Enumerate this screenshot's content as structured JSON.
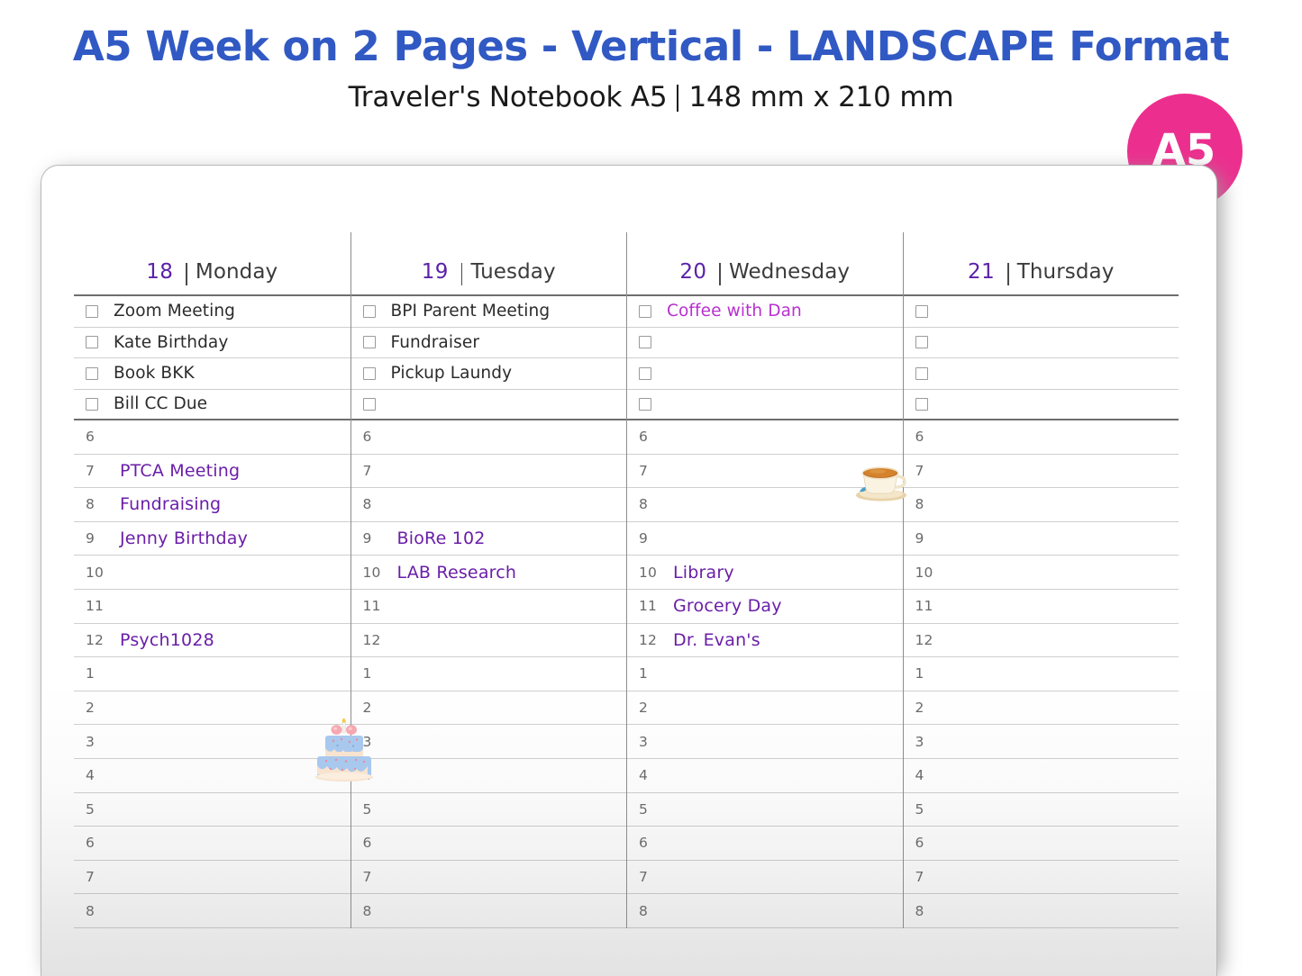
{
  "header": {
    "title": "A5 Week on 2 Pages - Vertical - LANDSCAPE Format",
    "subtitle_left": "Traveler's Notebook A5",
    "subtitle_right": "148 mm x 210 mm",
    "badge_label": "A5",
    "title_color": "#3159c4",
    "badge_color": "#ec2f8e"
  },
  "planner": {
    "accent_color": "#6a1ea8",
    "task_accent_color": "#b830cf",
    "day_number_color": "#5b21a8",
    "hour_labels": [
      "6",
      "7",
      "8",
      "9",
      "10",
      "11",
      "12",
      "1",
      "2",
      "3",
      "4",
      "5",
      "6",
      "7",
      "8"
    ],
    "days": [
      {
        "number": "18",
        "name": "Monday",
        "tasks": [
          {
            "text": "Zoom Meeting",
            "checked": false,
            "accent": false
          },
          {
            "text": "Kate Birthday",
            "checked": false,
            "accent": false
          },
          {
            "text": "Book BKK",
            "checked": false,
            "accent": false
          },
          {
            "text": "Bill CC Due",
            "checked": false,
            "accent": false
          }
        ],
        "hours": [
          "",
          "PTCA Meeting",
          "Fundraising",
          "Jenny Birthday",
          "",
          "",
          "Psych1028",
          "",
          "",
          "",
          "",
          "",
          "",
          "",
          ""
        ]
      },
      {
        "number": "19",
        "name": "Tuesday",
        "tasks": [
          {
            "text": "BPI Parent Meeting",
            "checked": false,
            "accent": false
          },
          {
            "text": "Fundraiser",
            "checked": false,
            "accent": false
          },
          {
            "text": "Pickup Laundy",
            "checked": false,
            "accent": false
          },
          {
            "text": "",
            "checked": false,
            "accent": false
          }
        ],
        "hours": [
          "",
          "",
          "",
          "BioRe 102",
          "LAB Research",
          "",
          "",
          "",
          "",
          "",
          "",
          "",
          "",
          "",
          ""
        ]
      },
      {
        "number": "20",
        "name": "Wednesday",
        "tasks": [
          {
            "text": "Coffee with Dan",
            "checked": false,
            "accent": true
          },
          {
            "text": "",
            "checked": false,
            "accent": false
          },
          {
            "text": "",
            "checked": false,
            "accent": false
          },
          {
            "text": "",
            "checked": false,
            "accent": false
          }
        ],
        "hours": [
          "",
          "",
          "",
          "",
          "Library",
          "Grocery Day",
          "Dr. Evan's",
          "",
          "",
          "",
          "",
          "",
          "",
          "",
          ""
        ]
      },
      {
        "number": "21",
        "name": "Thursday",
        "tasks": [
          {
            "text": "",
            "checked": false,
            "accent": false
          },
          {
            "text": "",
            "checked": false,
            "accent": false
          },
          {
            "text": "",
            "checked": false,
            "accent": false
          },
          {
            "text": "",
            "checked": false,
            "accent": false
          }
        ],
        "hours": [
          "",
          "",
          "",
          "",
          "",
          "",
          "",
          "",
          "",
          "",
          "",
          "",
          "",
          "",
          ""
        ]
      }
    ],
    "stickers": [
      {
        "name": "birthday-cake-sticker",
        "day": 0,
        "hour_index": 3
      },
      {
        "name": "coffee-cup-sticker",
        "day": 2,
        "task_index": 0
      }
    ]
  }
}
